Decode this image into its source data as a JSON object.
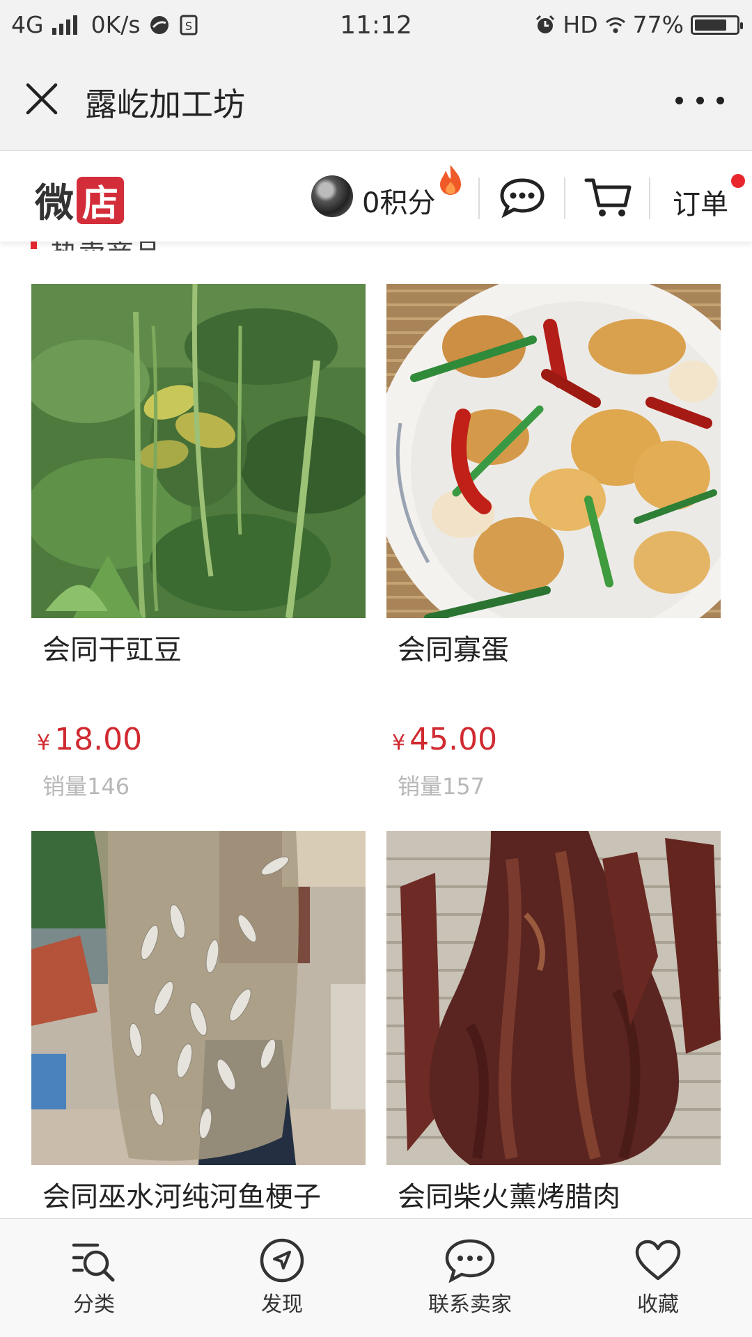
{
  "status_bar": {
    "network": "4G",
    "speed": "0K/s",
    "time": "11:12",
    "hd": "HD",
    "battery": "77%",
    "battery_level": 0.77
  },
  "title_bar": {
    "title": "露屹加工坊"
  },
  "shop_header": {
    "logo_left": "微",
    "logo_right": "店",
    "points": "0积分",
    "orders": "订单"
  },
  "section": {
    "title": "热卖商品"
  },
  "products": [
    {
      "name": "会同干豇豆",
      "currency": "¥",
      "price": "18.00",
      "sales": "销量146"
    },
    {
      "name": "会同寡蛋",
      "currency": "¥",
      "price": "45.00",
      "sales": "销量157"
    },
    {
      "name": "会同巫水河纯河鱼梗子"
    },
    {
      "name": "会同柴火薰烤腊肉"
    }
  ],
  "bottom_nav": [
    {
      "label": "分类",
      "icon": "category-search-icon"
    },
    {
      "label": "发现",
      "icon": "compass-icon"
    },
    {
      "label": "联系卖家",
      "icon": "chat-bubble-icon"
    },
    {
      "label": "收藏",
      "icon": "heart-icon"
    }
  ],
  "colors": {
    "accent_red": "#d02a30",
    "logo_red": "#d42d3a",
    "flame_orange": "#f05a28"
  }
}
